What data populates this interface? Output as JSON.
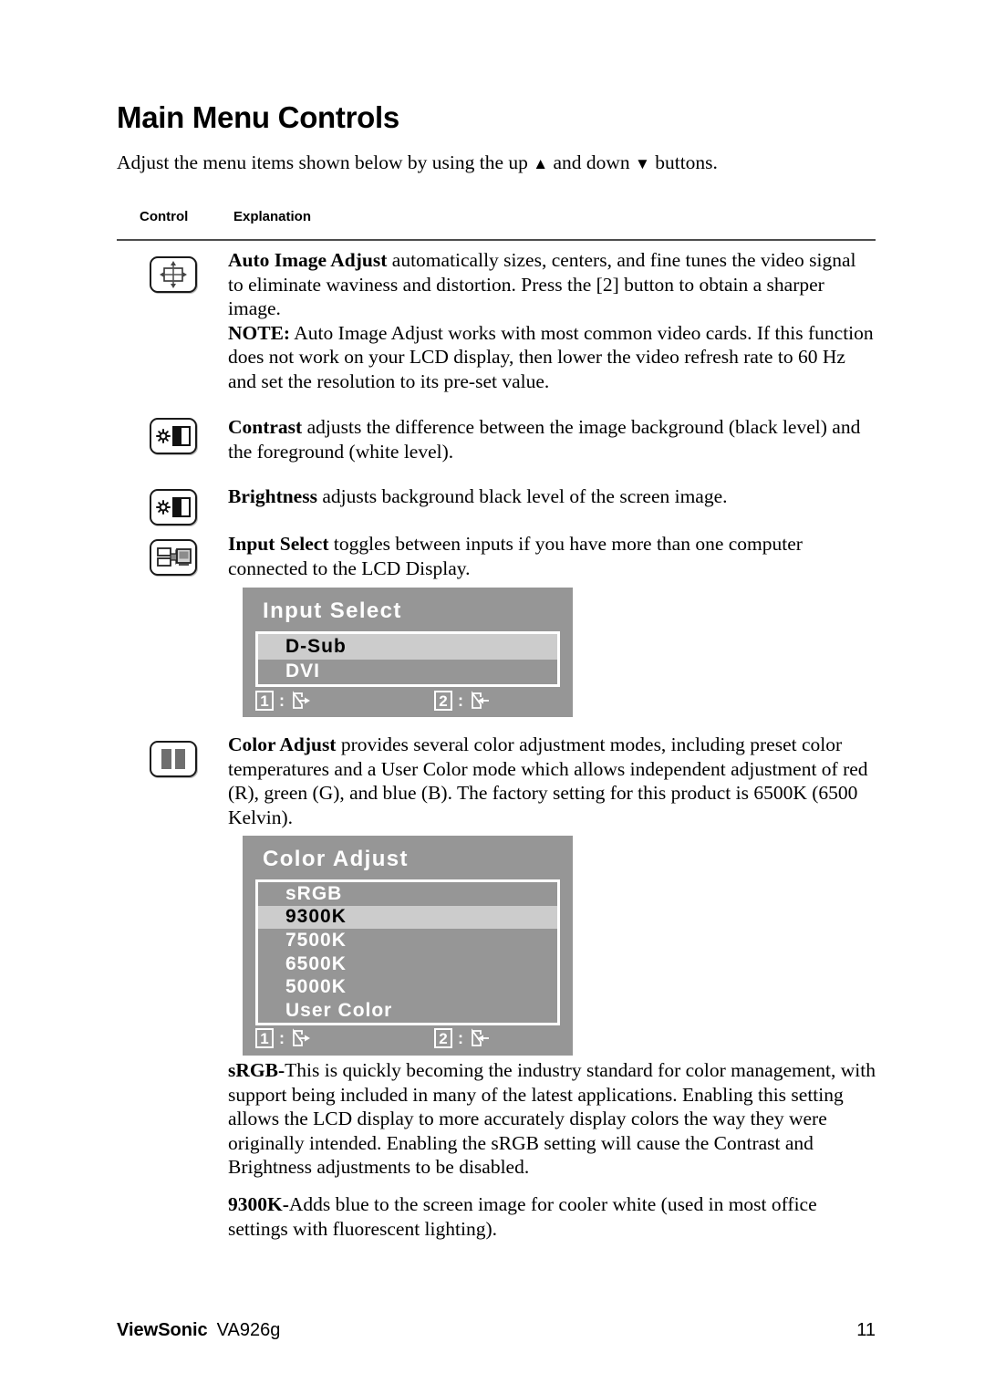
{
  "document": {
    "title": "Main Menu Controls",
    "intro_prefix": "Adjust the menu items shown below by using the up ",
    "intro_mid": " and down ",
    "intro_suffix": " buttons.",
    "up_glyph": "▲",
    "down_glyph": "▼"
  },
  "table": {
    "header_control": "Control",
    "header_explanation": "Explanation"
  },
  "rows": [
    {
      "icon": "auto-image-adjust-icon",
      "term": "Auto Image Adjust",
      "body": " automatically sizes, centers, and fine tunes the video signal to eliminate waviness and distortion. Press the [2] button to obtain a sharper image.",
      "note_label": "NOTE:",
      "note_body": " Auto Image Adjust works with most common video cards. If this function does not work on your LCD display, then lower the video refresh rate to 60 Hz and set the resolution to its pre-set value."
    },
    {
      "icon": "contrast-icon",
      "term": "Contrast",
      "body": " adjusts the difference between the image background  (black level) and the foreground (white level)."
    },
    {
      "icon": "brightness-icon",
      "term": "Brightness",
      "body": " adjusts background black level of the screen image."
    },
    {
      "icon": "input-select-icon",
      "term": "Input Select",
      "body": " toggles between inputs if you have more than one computer connected to the LCD Display."
    },
    {
      "icon": "color-adjust-icon",
      "term": "Color Adjust",
      "body": " provides several color adjustment modes, including preset color temperatures and a User Color mode which allows independent adjustment of red (R), green (G), and blue (B). The factory setting for this product is 6500K (6500 Kelvin)."
    }
  ],
  "osd_input_select": {
    "title": "Input Select",
    "items": [
      {
        "label": "D-Sub",
        "selected": true
      },
      {
        "label": "DVI",
        "selected": false
      }
    ],
    "footer": [
      {
        "key": "1",
        "separator": ":",
        "icon": "exit-out-icon"
      },
      {
        "key": "2",
        "separator": ":",
        "icon": "exit-in-icon"
      }
    ],
    "colors": {
      "background": "#969696",
      "selected_row": "#cccccc",
      "text": "#ffffff",
      "selected_text": "#000000"
    }
  },
  "osd_color_adjust": {
    "title": "Color Adjust",
    "items": [
      {
        "label": "sRGB",
        "selected": false
      },
      {
        "label": "9300K",
        "selected": true
      },
      {
        "label": "7500K",
        "selected": false
      },
      {
        "label": "6500K",
        "selected": false
      },
      {
        "label": "5000K",
        "selected": false
      },
      {
        "label": "User Color",
        "selected": false
      }
    ],
    "footer": [
      {
        "key": "1",
        "separator": ":",
        "icon": "exit-out-icon"
      },
      {
        "key": "2",
        "separator": ":",
        "icon": "exit-in-icon"
      }
    ],
    "colors": {
      "background": "#969696",
      "selected_row": "#cccccc",
      "text": "#ffffff",
      "selected_text": "#000000"
    }
  },
  "definitions": [
    {
      "term": "sRGB-",
      "body": "This is quickly becoming the industry standard for color management, with support being included in many of the latest applications. Enabling this setting allows the LCD display to more accurately display colors the way they were originally intended. Enabling the sRGB setting will cause the Contrast and Brightness adjustments to be disabled."
    },
    {
      "term": "9300K-",
      "body": "Adds blue to the screen image for cooler white (used in most office settings with fluorescent lighting)."
    }
  ],
  "footer": {
    "brand": "ViewSonic",
    "model": "VA926g",
    "page_number": "11"
  }
}
